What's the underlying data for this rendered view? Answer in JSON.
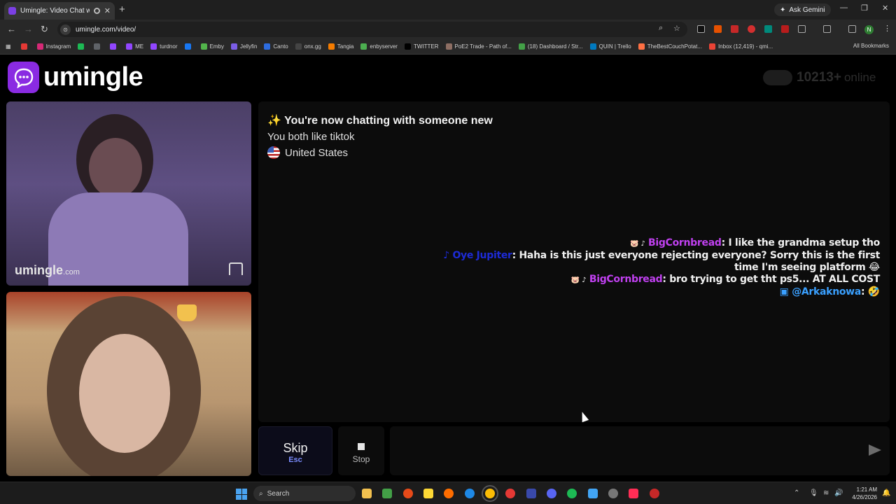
{
  "browser": {
    "tab_title": "Umingle: Video Chat with S",
    "new_tab": "+",
    "gemini": "Ask Gemini",
    "url": "umingle.com/video/",
    "profile_initial": "N",
    "bookmarks": [
      {
        "label": "",
        "color": "#e53935"
      },
      {
        "label": "Instagram",
        "color": "#d62976"
      },
      {
        "label": "",
        "color": "#1db954"
      },
      {
        "label": "",
        "color": "#5f6368"
      },
      {
        "label": "",
        "color": "#9146ff"
      },
      {
        "label": "ME",
        "color": "#9146ff"
      },
      {
        "label": "turdnor",
        "color": "#9146ff"
      },
      {
        "label": "",
        "color": "#1877f2"
      },
      {
        "label": "Emby",
        "color": "#52b54b"
      },
      {
        "label": "Jellyfin",
        "color": "#7b5de6"
      },
      {
        "label": "Canto",
        "color": "#2d6cdf"
      },
      {
        "label": "onx.gg",
        "color": "#444"
      },
      {
        "label": "Tangia",
        "color": "#f57c00"
      },
      {
        "label": "enbyserver",
        "color": "#4caf50"
      },
      {
        "label": "TWITTER",
        "color": "#000"
      },
      {
        "label": "PoE2 Trade - Path of...",
        "color": "#8d6e63"
      },
      {
        "label": "(18) Dashboard / Str...",
        "color": "#43a047"
      },
      {
        "label": "QUIN | Trello",
        "color": "#0079bf"
      },
      {
        "label": "TheBestCouchPotat...",
        "color": "#ff7043"
      },
      {
        "label": "Inbox (12,419) - qmi...",
        "color": "#ea4335"
      }
    ],
    "all_bookmarks": "All Bookmarks"
  },
  "site": {
    "logo_text": "umingle",
    "online_count": "10213+",
    "online_label": "online",
    "watermark_main": "umingle",
    "watermark_suffix": ".com"
  },
  "chat": {
    "system_title": "You're now chatting with someone new",
    "common_interest": "You both like tiktok",
    "country": "United States",
    "messages": {
      "m1_user": "BigCornbread",
      "m1_text": ": I like the grandma setup tho",
      "m2_user": "Oye Jupiter",
      "m2_text": ": Haha is this just everyone rejecting everyone? Sorry this is the first time I'm seeing platform",
      "m3_user": "BigCornbread",
      "m3_text": ": bro trying to get tht ps5... AT ALL COST",
      "m4_user": "@Arkaknowa",
      "m4_text": ":"
    }
  },
  "controls": {
    "skip_label": "Skip",
    "skip_key": "Esc",
    "stop_label": "Stop",
    "message_placeholder": ""
  },
  "taskbar": {
    "search": "Search",
    "time": "1:21 AM",
    "date": "4/26/2026"
  }
}
